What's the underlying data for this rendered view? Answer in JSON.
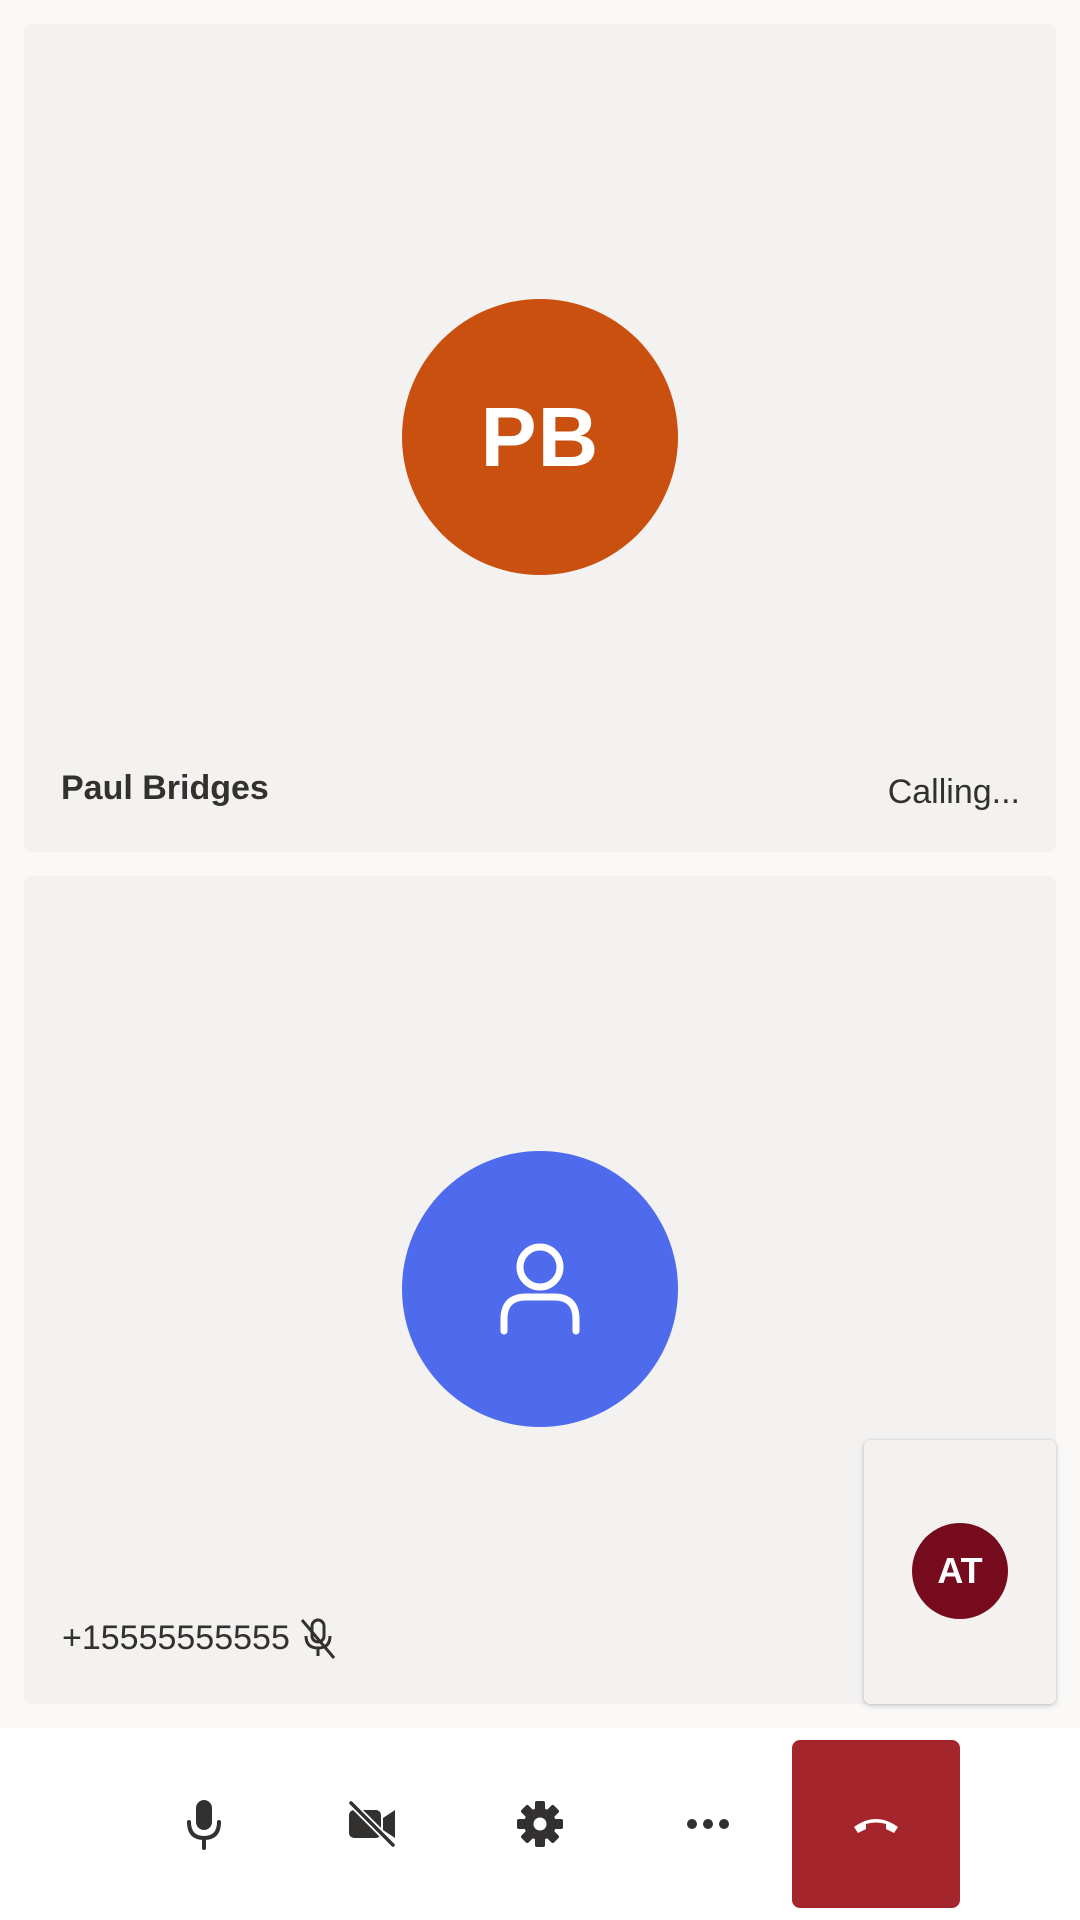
{
  "remote_participant": {
    "initials": "PB",
    "name": "Paul Bridges",
    "status": "Calling...",
    "avatar_color": "#ca5010"
  },
  "pstn_participant": {
    "phone_number": "+15555555555",
    "avatar_color": "#4f6bed",
    "avatar_icon": "person-icon",
    "muted": true,
    "muted_icon": "mic-off-icon"
  },
  "local_preview": {
    "initials": "AT",
    "avatar_color": "#750b1c"
  },
  "controls": {
    "microphone_icon": "microphone-icon",
    "camera_icon": "camera-off-icon",
    "settings_icon": "gear-icon",
    "more_icon": "more-horizontal-icon",
    "hangup_icon": "phone-hangup-icon",
    "hangup_color": "#a4262c",
    "icon_color": "#323130"
  }
}
